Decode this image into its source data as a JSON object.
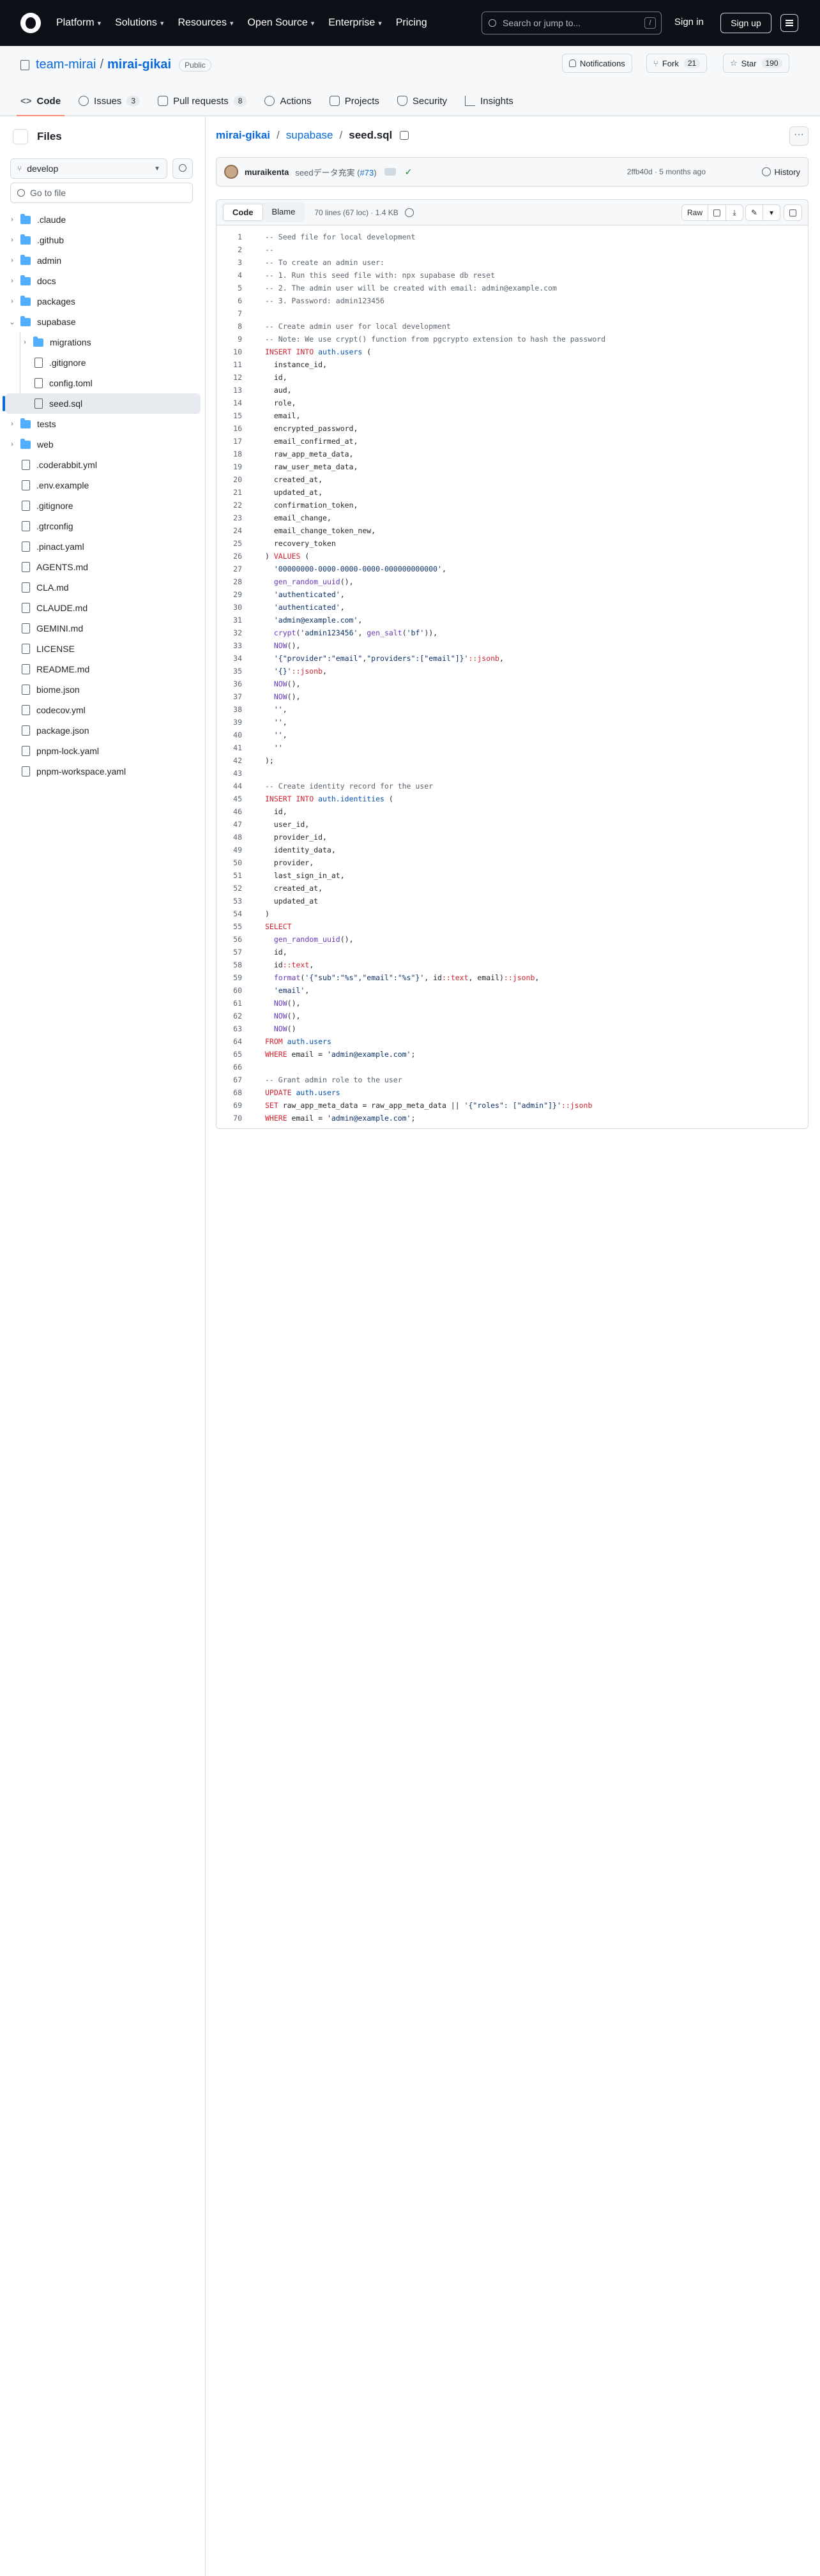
{
  "topbar": {
    "nav": [
      {
        "label": "Platform"
      },
      {
        "label": "Solutions"
      },
      {
        "label": "Resources"
      },
      {
        "label": "Open Source"
      },
      {
        "label": "Enterprise"
      },
      {
        "label": "Pricing"
      }
    ],
    "search_placeholder": "Search or jump to...",
    "search_shortcut": "/",
    "signin": "Sign in",
    "signup": "Sign up"
  },
  "repo": {
    "owner": "team-mirai",
    "separator": "/",
    "name": "mirai-gikai",
    "visibility": "Public",
    "notifications": "Notifications",
    "fork_label": "Fork",
    "fork_count": "21",
    "star_label": "Star",
    "star_count": "190",
    "tabs": [
      {
        "label": "Code",
        "count": ""
      },
      {
        "label": "Issues",
        "count": "3"
      },
      {
        "label": "Pull requests",
        "count": "8"
      },
      {
        "label": "Actions",
        "count": ""
      },
      {
        "label": "Projects",
        "count": ""
      },
      {
        "label": "Security",
        "count": ""
      },
      {
        "label": "Insights",
        "count": ""
      }
    ]
  },
  "sidebar": {
    "title": "Files",
    "branch": "develop",
    "goto_placeholder": "Go to file",
    "tree": [
      {
        "label": ".claude"
      },
      {
        "label": ".github"
      },
      {
        "label": "admin"
      },
      {
        "label": "docs"
      },
      {
        "label": "packages"
      },
      {
        "label": "supabase"
      },
      {
        "label": "migrations"
      },
      {
        "label": ".gitignore"
      },
      {
        "label": "config.toml"
      },
      {
        "label": "seed.sql"
      },
      {
        "label": "tests"
      },
      {
        "label": "web"
      },
      {
        "label": ".coderabbit.yml"
      },
      {
        "label": ".env.example"
      },
      {
        "label": ".gitignore"
      },
      {
        "label": ".gtrconfig"
      },
      {
        "label": ".pinact.yaml"
      },
      {
        "label": "AGENTS.md"
      },
      {
        "label": "CLA.md"
      },
      {
        "label": "CLAUDE.md"
      },
      {
        "label": "GEMINI.md"
      },
      {
        "label": "LICENSE"
      },
      {
        "label": "README.md"
      },
      {
        "label": "biome.json"
      },
      {
        "label": "codecov.yml"
      },
      {
        "label": "package.json"
      },
      {
        "label": "pnpm-lock.yaml"
      },
      {
        "label": "pnpm-workspace.yaml"
      }
    ]
  },
  "breadcrumb": {
    "root": "mirai-gikai",
    "folder": "supabase",
    "file": "seed.sql",
    "sep": "/"
  },
  "commit": {
    "author": "muraikenta",
    "message": "seedデータ充実 (",
    "pr": "#73",
    "message_end": ")",
    "check": "✓",
    "meta": "2ffb40d · 5 months ago",
    "history": "History"
  },
  "file": {
    "code_tab": "Code",
    "blame_tab": "Blame",
    "stats": "70 lines (67 loc) · 1.4 KB",
    "raw": "Raw"
  },
  "code_lines": [
    "-- Seed file for local development",
    "--",
    "-- To create an admin user:",
    "-- 1. Run this seed file with: npx supabase db reset",
    "-- 2. The admin user will be created with email: admin@example.com",
    "-- 3. Password: admin123456",
    "",
    "-- Create admin user for local development",
    "-- Note: We use crypt() function from pgcrypto extension to hash the password",
    "INSERT INTO auth.users (",
    "  instance_id,",
    "  id,",
    "  aud,",
    "  role,",
    "  email,",
    "  encrypted_password,",
    "  email_confirmed_at,",
    "  raw_app_meta_data,",
    "  raw_user_meta_data,",
    "  created_at,",
    "  updated_at,",
    "  confirmation_token,",
    "  email_change,",
    "  email_change_token_new,",
    "  recovery_token",
    ") VALUES (",
    "  '00000000-0000-0000-0000-000000000000',",
    "  gen_random_uuid(),",
    "  'authenticated',",
    "  'authenticated',",
    "  'admin@example.com',",
    "  crypt('admin123456', gen_salt('bf')),",
    "  NOW(),",
    "  '{\"provider\":\"email\",\"providers\":[\"email\"]}'::jsonb,",
    "  '{}'::jsonb,",
    "  NOW(),",
    "  NOW(),",
    "  '',",
    "  '',",
    "  '',",
    "  ''",
    ");",
    "",
    "-- Create identity record for the user",
    "INSERT INTO auth.identities (",
    "  id,",
    "  user_id,",
    "  provider_id,",
    "  identity_data,",
    "  provider,",
    "  last_sign_in_at,",
    "  created_at,",
    "  updated_at",
    ")",
    "SELECT",
    "  gen_random_uuid(),",
    "  id,",
    "  id::text,",
    "  format('{\"sub\":\"%s\",\"email\":\"%s\"}', id::text, email)::jsonb,",
    "  'email',",
    "  NOW(),",
    "  NOW(),",
    "  NOW()",
    "FROM auth.users",
    "WHERE email = 'admin@example.com';",
    "",
    "-- Grant admin role to the user",
    "UPDATE auth.users",
    "SET raw_app_meta_data = raw_app_meta_data || '{\"roles\": [\"admin\"]}'::jsonb",
    "WHERE email = 'admin@example.com';"
  ]
}
